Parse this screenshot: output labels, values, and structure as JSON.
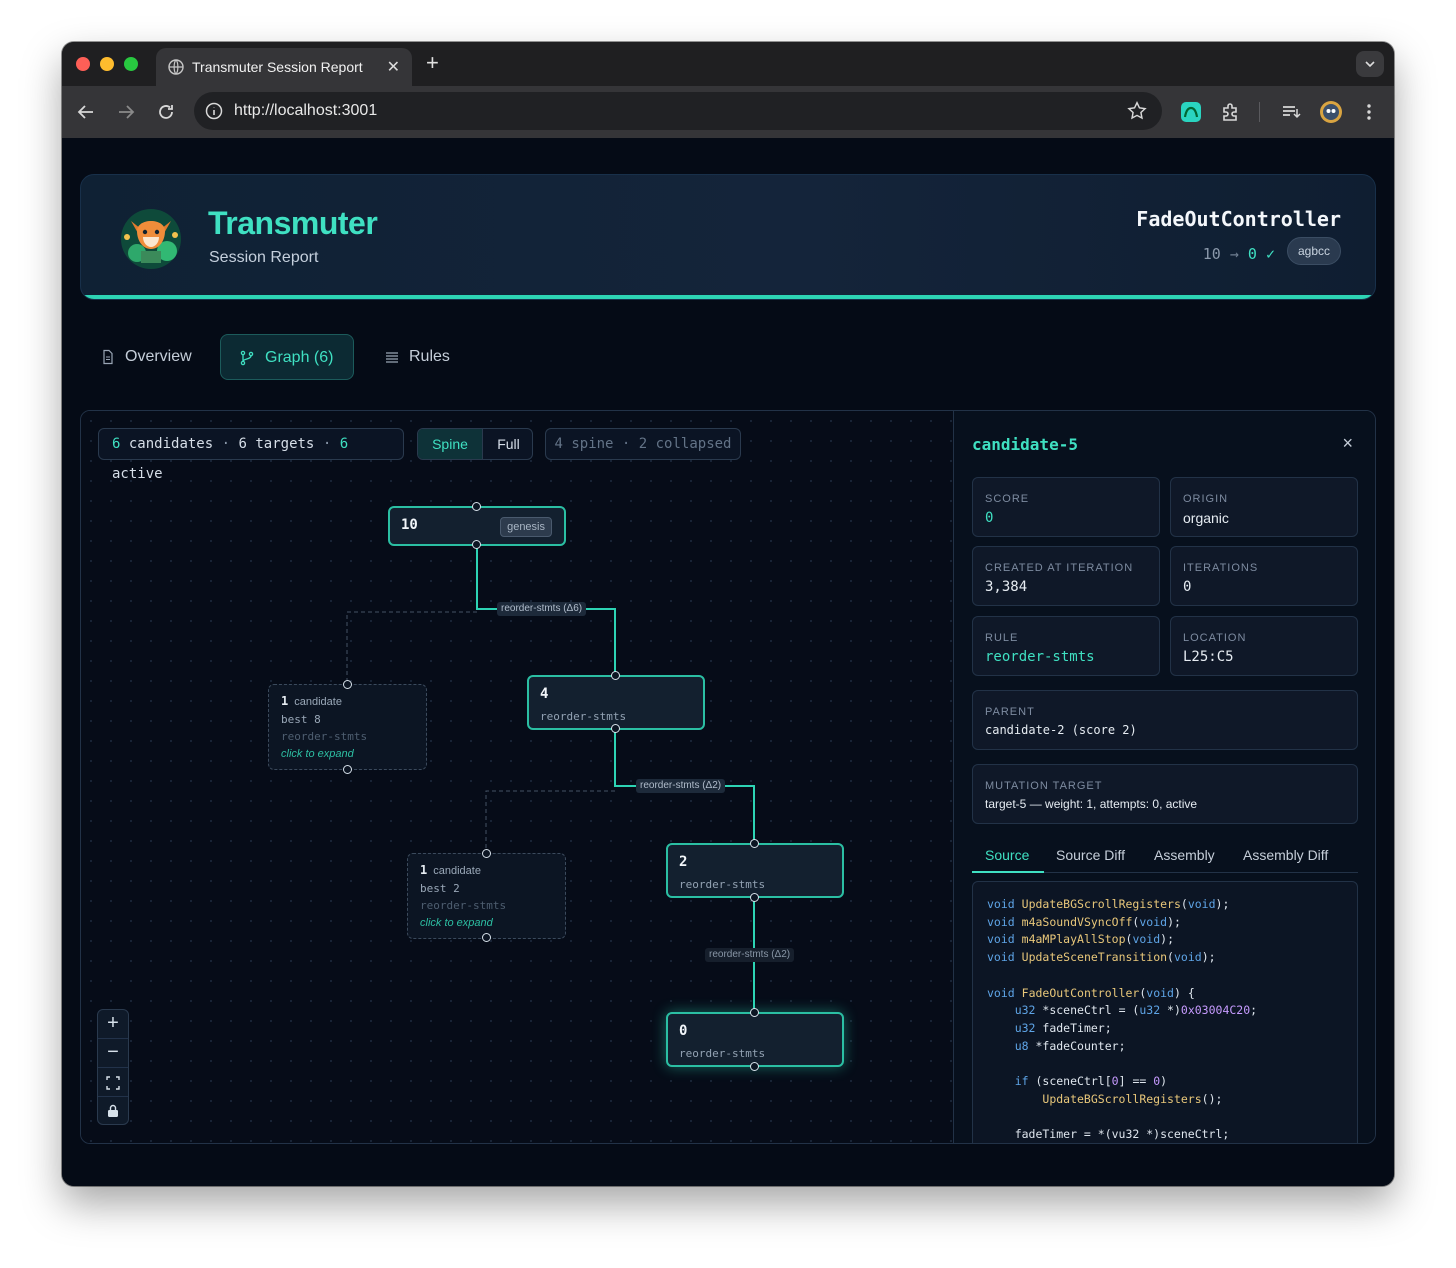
{
  "browser": {
    "tab_title": "Transmuter Session Report",
    "url": "http://localhost:3001",
    "new_tab": "+",
    "close_tab": "✕"
  },
  "header": {
    "brand": "Transmuter",
    "subtitle": "Session Report",
    "function_name": "FadeOutController",
    "score_from": "10",
    "score_to": "0",
    "arrow": "→",
    "check": "✓",
    "compiler": "agbcc"
  },
  "nav": {
    "tabs": [
      {
        "label": "Overview"
      },
      {
        "label": "Graph (6)"
      },
      {
        "label": "Rules"
      }
    ],
    "active": "Graph (6)"
  },
  "graph": {
    "stats": {
      "candidates_n": "6",
      "candidates": "candidates",
      "targets_n": "6",
      "targets": "targets",
      "active_n": "6",
      "active": "active",
      "sep": "·"
    },
    "view_modes": [
      "Spine",
      "Full"
    ],
    "active_view": "Spine",
    "spine_info": "4 spine · 2 collapsed",
    "nodes": [
      {
        "value": "10",
        "badge": "genesis"
      },
      {
        "value": "4",
        "rule": "reorder-stmts"
      },
      {
        "value": "2",
        "rule": "reorder-stmts"
      },
      {
        "value": "0",
        "rule": "reorder-stmts"
      }
    ],
    "collapsed": [
      {
        "count": "1",
        "label": "candidate",
        "best": "best 8",
        "rule": "reorder-stmts",
        "hint": "click to expand"
      },
      {
        "count": "1",
        "label": "candidate",
        "best": "best 2",
        "rule": "reorder-stmts",
        "hint": "click to expand"
      }
    ],
    "edges": [
      "reorder-stmts (Δ6)",
      "reorder-stmts (Δ2)",
      "reorder-stmts (Δ2)"
    ],
    "zoom": {
      "in": "+",
      "out": "−"
    }
  },
  "details": {
    "title": "candidate-5",
    "close": "×",
    "fields": {
      "score": {
        "label": "SCORE",
        "value": "0"
      },
      "origin": {
        "label": "ORIGIN",
        "value": "organic"
      },
      "created": {
        "label": "CREATED AT ITERATION",
        "value": "3,384"
      },
      "iterations": {
        "label": "ITERATIONS",
        "value": "0"
      },
      "rule": {
        "label": "RULE",
        "value": "reorder-stmts"
      },
      "location": {
        "label": "LOCATION",
        "value": "L25:C5"
      },
      "parent": {
        "label": "PARENT",
        "value": "candidate-2 (score 2)"
      },
      "target": {
        "label": "MUTATION TARGET",
        "value": "target-5 — weight: 1, attempts: 0, active"
      }
    },
    "tabs": [
      "Source",
      "Source Diff",
      "Assembly",
      "Assembly Diff"
    ],
    "active_tab": "Source"
  },
  "colors": {
    "accent": "#3fe0c2",
    "background": "#050b16",
    "panel": "#0f1828",
    "border": "#223247"
  }
}
